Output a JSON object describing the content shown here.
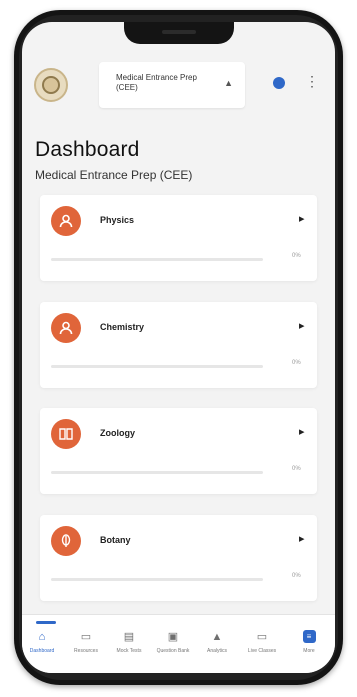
{
  "header": {
    "course_selector": "Medical Entrance Prep (CEE)",
    "dropdown_arrow": "▲"
  },
  "page": {
    "title": "Dashboard",
    "subtitle": "Medical Entrance Prep (CEE)"
  },
  "subjects": [
    {
      "name": "Physics",
      "progress_text": "0%",
      "progress": 0,
      "icon": "person-icon"
    },
    {
      "name": "Chemistry",
      "progress_text": "0%",
      "progress": 0,
      "icon": "person-icon"
    },
    {
      "name": "Zoology",
      "progress_text": "0%",
      "progress": 0,
      "icon": "book-icon"
    },
    {
      "name": "Botany",
      "progress_text": "0%",
      "progress": 0,
      "icon": "leaf-icon"
    }
  ],
  "bottom_nav": [
    {
      "label": "Dashboard",
      "icon": "home-icon",
      "active": true
    },
    {
      "label": "Resources",
      "icon": "resources-icon",
      "active": false
    },
    {
      "label": "Mock Tests",
      "icon": "tests-icon",
      "active": false
    },
    {
      "label": "Question Bank",
      "icon": "question-bank-icon",
      "active": false
    },
    {
      "label": "Analytics",
      "icon": "analytics-icon",
      "active": false
    },
    {
      "label": "Live Classes",
      "icon": "live-icon",
      "active": false
    },
    {
      "label": "More",
      "icon": "more-icon",
      "active": false
    }
  ],
  "colors": {
    "accent": "#e0653a",
    "primary": "#2f68c8"
  }
}
